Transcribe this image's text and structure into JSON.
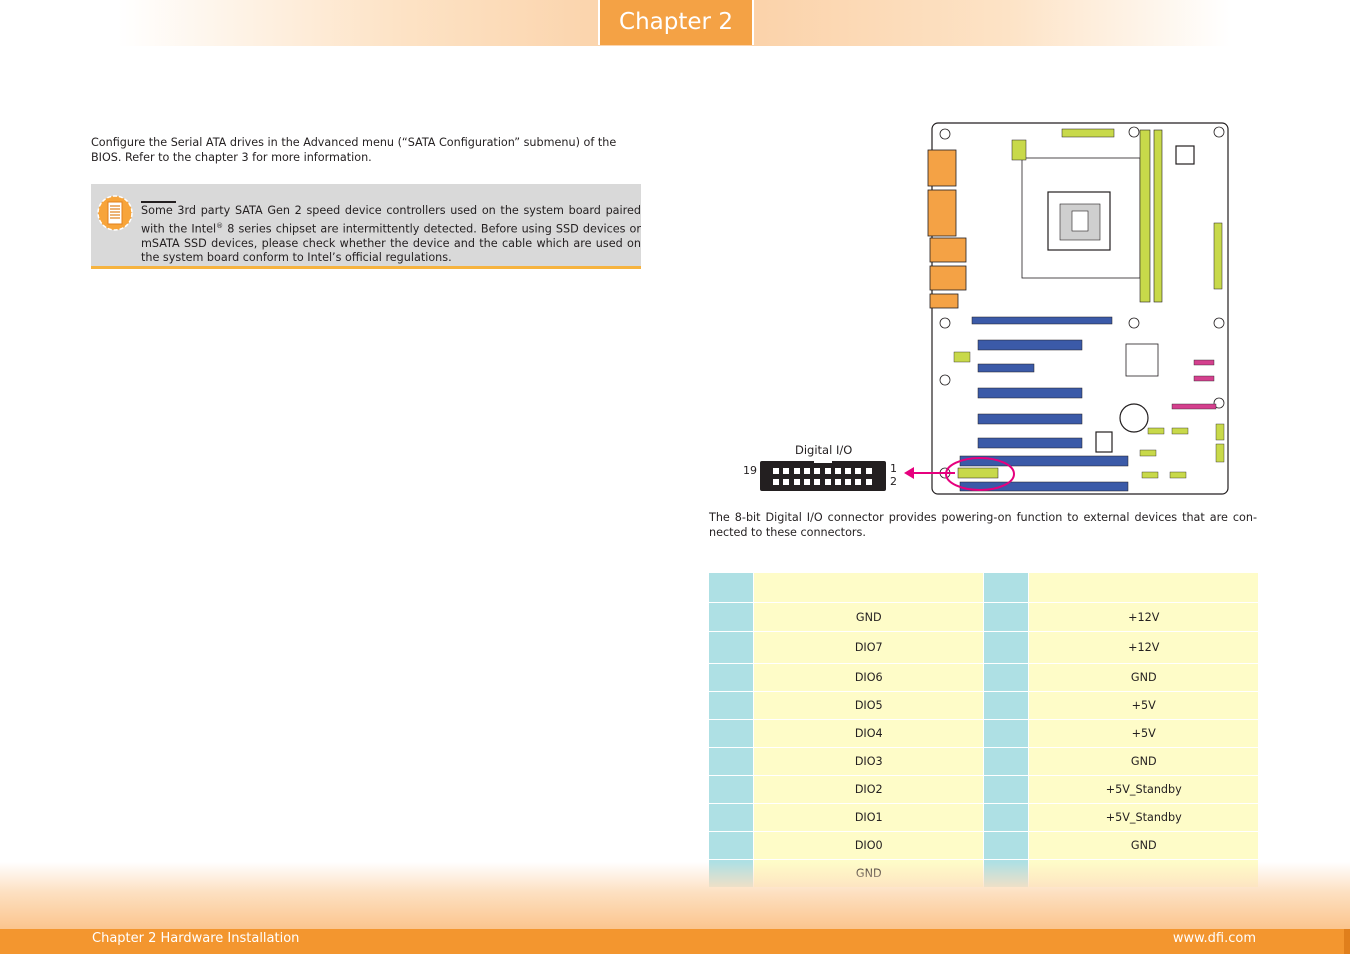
{
  "header": {
    "chapter_tab": "Chapter 2"
  },
  "intro": {
    "text": "Configure the Serial ATA drives in the Advanced menu (“SATA Configuration” submenu) of the BIOS. Refer to the chapter 3 for more information."
  },
  "note": {
    "text_before_sup": "Some 3rd party SATA Gen 2 speed device controllers used on the system board paired with the Intel",
    "sup": "®",
    "text_after_sup": " 8 series chipset are intermittently detected. Before using SSD devices or mSATA SSD devices, please check whether the device and the cable which are used on the system board conform to Intel’s official regulations.",
    "icon": "note-icon"
  },
  "connector": {
    "label": "Digital I/O",
    "pin_19": "19",
    "pin_1": "1",
    "pin_2": "2"
  },
  "description": {
    "text": "The 8-bit Digital I/O connector provides powering-on function to external devices that are con-nected to these connectors."
  },
  "pin_table": {
    "rows": [
      {
        "a": "",
        "b": ""
      },
      {
        "a": "GND",
        "b": "+12V"
      },
      {
        "a": "DIO7",
        "b": "+12V"
      },
      {
        "a": "DIO6",
        "b": "GND"
      },
      {
        "a": "DIO5",
        "b": "+5V"
      },
      {
        "a": "DIO4",
        "b": "+5V"
      },
      {
        "a": "DIO3",
        "b": "GND"
      },
      {
        "a": "DIO2",
        "b": "+5V_Standby"
      },
      {
        "a": "DIO1",
        "b": "+5V_Standby"
      },
      {
        "a": "DIO0",
        "b": "GND"
      },
      {
        "a": "GND",
        "b": ""
      }
    ]
  },
  "footer": {
    "left": "Chapter 2 Hardware Installation",
    "right": "www.dfi.com"
  },
  "colors": {
    "accent_orange": "#f4a245",
    "pin_cell": "#aee0e4",
    "assign_cell": "#fefcc8",
    "highlight_magenta": "#e6007e"
  }
}
